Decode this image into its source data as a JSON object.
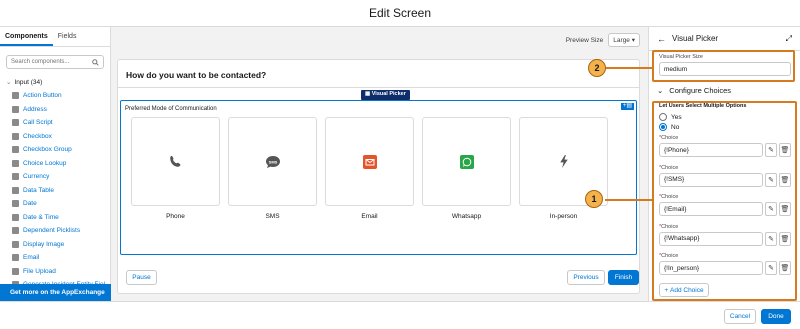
{
  "title": "Edit Screen",
  "left_panel": {
    "tabs": [
      "Components",
      "Fields"
    ],
    "search_placeholder": "Search components...",
    "section": "Input (34)",
    "items": [
      "Action Button",
      "Address",
      "Call Script",
      "Checkbox",
      "Checkbox Group",
      "Choice Lookup",
      "Currency",
      "Data Table",
      "Date",
      "Date & Time",
      "Dependent Picklists",
      "Display Image",
      "Email",
      "File Upload",
      "Generate Incident Entity Fiel"
    ],
    "appexchange": "Get more on the AppExchange"
  },
  "canvas": {
    "preview_size_label": "Preview Size",
    "preview_size_value": "Large",
    "question": "How do you want to be contacted?",
    "component_tag": "Visual Picker",
    "picker_label": "Preferred Mode of Communication",
    "cards": [
      "Phone",
      "SMS",
      "Email",
      "Whatsapp",
      "In-person"
    ],
    "pause": "Pause",
    "previous": "Previous",
    "finish": "Finish"
  },
  "right_panel": {
    "title": "Visual Picker",
    "size_label": "Visual Picker Size",
    "size_value": "medium",
    "section": "Configure Choices",
    "multi_label": "Let Users Select Multiple Options",
    "yes": "Yes",
    "no": "No",
    "choice_label": "Choice",
    "choices": [
      "{!Phone}",
      "{!SMS}",
      "{!Email}",
      "{!Whatsapp}",
      "{!In_person}"
    ],
    "add_choice": "Add Choice"
  },
  "footer": {
    "cancel": "Cancel",
    "done": "Done"
  },
  "callouts": [
    "1",
    "2"
  ],
  "colors": {
    "brand": "#0176d3",
    "callout": "#d67a20",
    "badge": "#f3b24c"
  }
}
